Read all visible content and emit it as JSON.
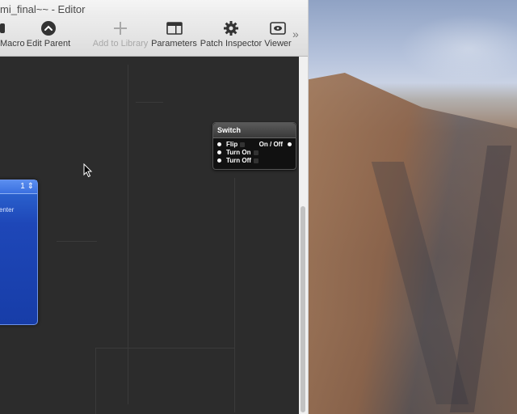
{
  "window": {
    "title": "mi_final~~ - Editor"
  },
  "toolbar": {
    "items": [
      {
        "label": "Macro",
        "icon": "macro-icon"
      },
      {
        "label": "Edit Parent",
        "icon": "edit-parent-icon"
      },
      {
        "label": "Add to Library",
        "icon": "plus-icon",
        "disabled": true
      },
      {
        "label": "Parameters",
        "icon": "parameters-icon"
      },
      {
        "label": "Patch Inspector",
        "icon": "gear-icon"
      },
      {
        "label": "Viewer",
        "icon": "eye-icon"
      }
    ],
    "overflow": "»"
  },
  "canvas": {
    "blue_patch": {
      "header_symbol": "1 ⇕",
      "port_label": "enter"
    },
    "switch_patch": {
      "title": "Switch",
      "inputs": [
        "Flip",
        "Turn On",
        "Turn Off"
      ],
      "output": "On / Off"
    }
  },
  "colors": {
    "accent": "#2f6bd6",
    "canvas": "#2c2c2c",
    "patch_dark": "#111111"
  }
}
